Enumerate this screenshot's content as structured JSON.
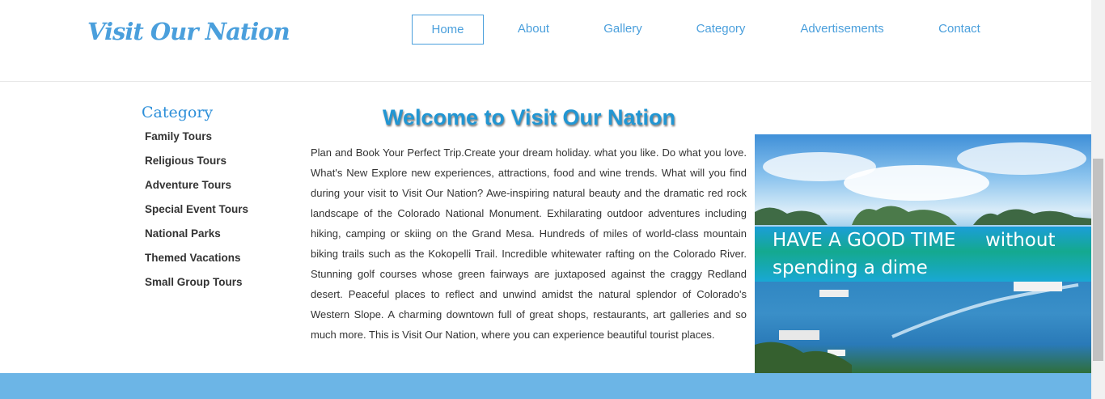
{
  "header": {
    "logo": "Visit Our Nation",
    "nav": [
      {
        "label": "Home",
        "active": true
      },
      {
        "label": "About"
      },
      {
        "label": "Gallery"
      },
      {
        "label": "Category"
      },
      {
        "label": "Advertisements"
      },
      {
        "label": "Contact"
      }
    ]
  },
  "sidebar": {
    "title": "Category",
    "items": [
      {
        "label": "Family Tours"
      },
      {
        "label": "Religious Tours"
      },
      {
        "label": "Adventure Tours"
      },
      {
        "label": "Special Event Tours"
      },
      {
        "label": "National Parks"
      },
      {
        "label": "Themed Vacations"
      },
      {
        "label": "Small Group Tours"
      }
    ]
  },
  "main": {
    "title": "Welcome to Visit Our Nation",
    "paragraph": "Plan and Book Your Perfect Trip.Create your dream holiday. what you like. Do what you love. What's New Explore new experiences, attractions, food and wine trends. What will you find during your visit to Visit Our Nation? Awe-inspiring natural beauty and the dramatic red rock landscape of the Colorado National Monument. Exhilarating outdoor adventures including hiking, camping or skiing on the Grand Mesa. Hundreds of miles of world-class mountain biking trails such as the Kokopelli Trail. Incredible whitewater rafting on the Colorado River. Stunning golf courses whose green fairways are juxtaposed against the craggy Redland desert. Peaceful places to reflect and unwind amidst the natural splendor of Colorado's Western Slope. A charming downtown full of great shops, restaurants, art galleries and so much more. This is Visit Our Nation, where you can experience beautiful tourist places."
  },
  "banner": {
    "text": "HAVE A GOOD TIME     without spending a dime"
  },
  "colors": {
    "accent": "#4a9fdc",
    "title": "#2196d3",
    "footer": "#6cb5e6"
  }
}
